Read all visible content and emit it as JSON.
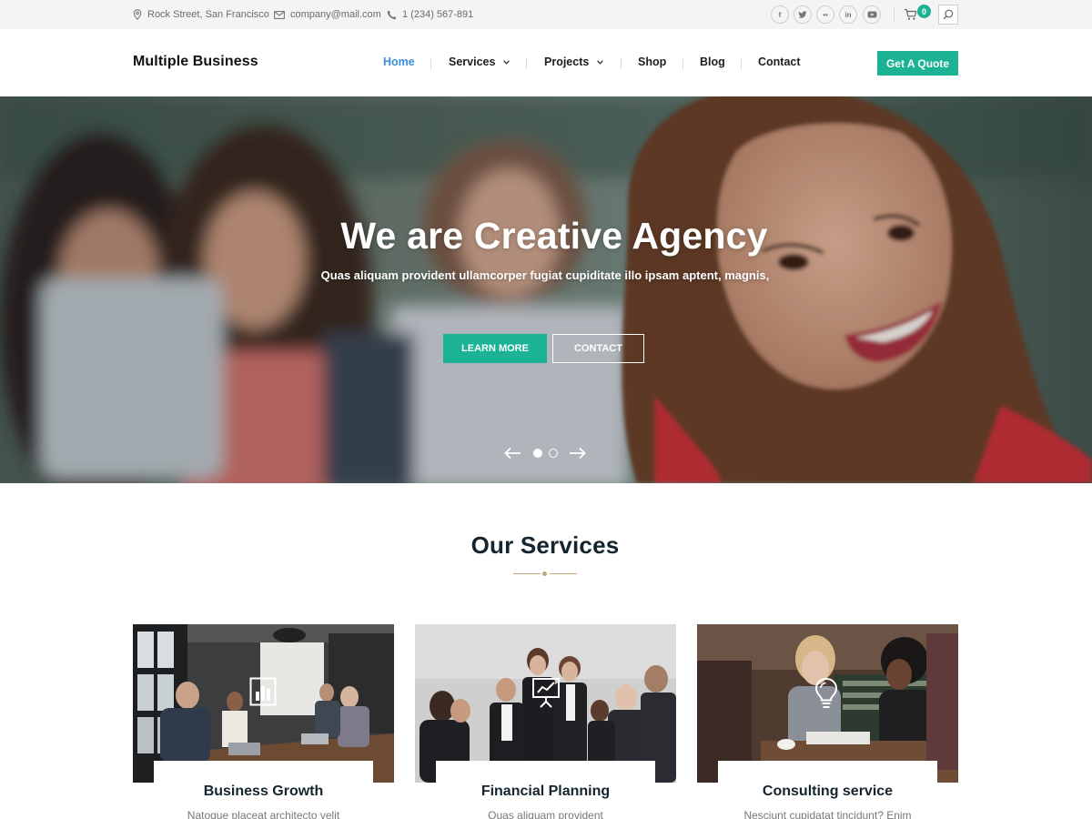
{
  "topbar": {
    "address": "Rock Street, San Francisco",
    "email": "company@mail.com",
    "phone": "1 (234) 567-891",
    "social": [
      {
        "icon": "facebook-icon",
        "glyph": "f"
      },
      {
        "icon": "twitter-icon",
        "glyph": "t"
      },
      {
        "icon": "flickr-icon",
        "glyph": "••"
      },
      {
        "icon": "linkedin-icon",
        "glyph": "in"
      },
      {
        "icon": "youtube-icon",
        "glyph": "▶"
      }
    ],
    "cart_count": "0"
  },
  "header": {
    "logo": "Multiple Business",
    "nav": [
      {
        "label": "Home",
        "active": true,
        "dropdown": false
      },
      {
        "label": "Services",
        "active": false,
        "dropdown": true
      },
      {
        "label": "Projects",
        "active": false,
        "dropdown": true
      },
      {
        "label": "Shop",
        "active": false,
        "dropdown": false
      },
      {
        "label": "Blog",
        "active": false,
        "dropdown": false
      },
      {
        "label": "Contact",
        "active": false,
        "dropdown": false
      }
    ],
    "cta": "Get A Quote"
  },
  "hero": {
    "title": "We are Creative Agency",
    "subtitle": "Quas aliquam provident ullamcorper fugiat cupiditate illo ipsam aptent, magnis,",
    "primary_button": "LEARN MORE",
    "secondary_button": "CONTACT",
    "slides_total": 2,
    "active_slide": 1
  },
  "services": {
    "title": "Our Services",
    "cards": [
      {
        "title": "Business Growth",
        "description": "Natoque placeat architecto velit",
        "icon": "bar-chart-icon"
      },
      {
        "title": "Financial Planning",
        "description": "Quas aliquam provident",
        "icon": "presentation-board-icon"
      },
      {
        "title": "Consulting service",
        "description": "Nesciunt cupidatat tincidunt? Enim",
        "icon": "lightbulb-icon"
      }
    ]
  },
  "colors": {
    "accent": "#1bb394",
    "nav_active": "#3b8fd8",
    "heading": "#152530",
    "divider": "#c4a57a",
    "topbar_bg": "#f4f4f4"
  }
}
